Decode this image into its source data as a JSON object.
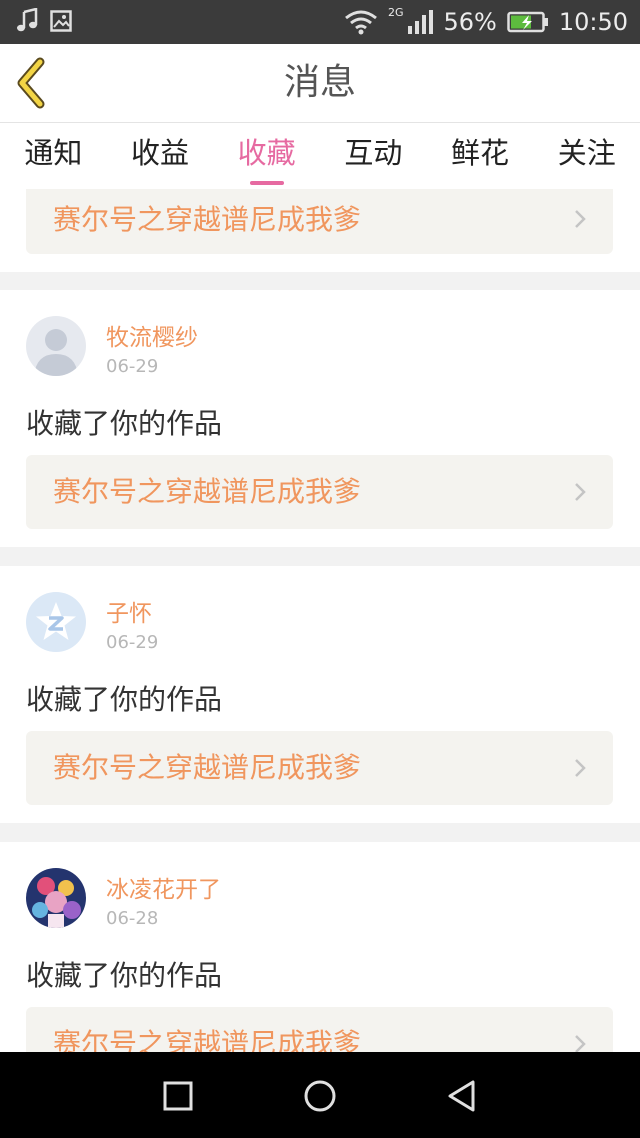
{
  "status_bar": {
    "network": "2G",
    "battery": "56%",
    "time": "10:50",
    "icons": [
      "music-note-icon",
      "image-icon",
      "wifi-icon",
      "signal-icon",
      "battery-icon"
    ]
  },
  "header": {
    "title": "消息",
    "back_icon": "chevron-left-icon"
  },
  "tabs": [
    {
      "label": "通知"
    },
    {
      "label": "收益"
    },
    {
      "label": "收藏",
      "active": true
    },
    {
      "label": "互动"
    },
    {
      "label": "鲜花"
    },
    {
      "label": "关注"
    }
  ],
  "partial_item": {
    "work_title": "赛尔号之穿越谱尼成我爹"
  },
  "items": [
    {
      "username": "牧流樱纱",
      "date": "06-29",
      "action": "收藏了你的作品",
      "work_title": "赛尔号之穿越谱尼成我爹",
      "avatar": "default-avatar"
    },
    {
      "username": "子怀",
      "date": "06-29",
      "action": "收藏了你的作品",
      "work_title": "赛尔号之穿越谱尼成我爹",
      "avatar": "qq-star-avatar"
    },
    {
      "username": "冰凌花开了",
      "date": "06-28",
      "action": "收藏了你的作品",
      "work_title": "赛尔号之穿越谱尼成我爹",
      "avatar": "anime-avatar"
    }
  ],
  "colors": {
    "accent": "#e66aa1",
    "name": "#f0965e",
    "work_bg": "#f4f3ef"
  },
  "nav_bar": {
    "buttons": [
      "recent-apps-icon",
      "home-icon",
      "back-triangle-icon"
    ]
  }
}
